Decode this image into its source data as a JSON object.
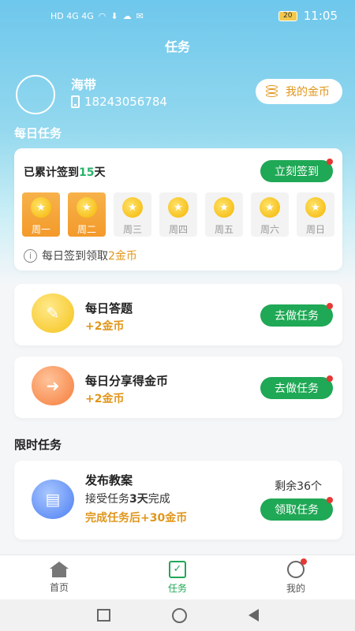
{
  "status_bar": {
    "left_indicators": "HD 4G 4G",
    "battery_level": "20",
    "time": "11:05"
  },
  "header": {
    "title": "任务"
  },
  "user": {
    "name": "海带",
    "phone": "18243056784",
    "coin_button_label": "我的金币"
  },
  "daily": {
    "section_title": "每日任务",
    "checkin": {
      "title_prefix": "已累计签到",
      "days_count": "15",
      "title_suffix": "天",
      "button_label": "立刻签到",
      "note_prefix": "每日签到领取",
      "note_amount": "2金币",
      "days": [
        {
          "label": "周一",
          "checked": true
        },
        {
          "label": "周二",
          "checked": true
        },
        {
          "label": "周三",
          "checked": false
        },
        {
          "label": "周四",
          "checked": false
        },
        {
          "label": "周五",
          "checked": false
        },
        {
          "label": "周六",
          "checked": false
        },
        {
          "label": "周日",
          "checked": false
        }
      ]
    },
    "tasks": [
      {
        "name": "每日答题",
        "reward": "+2金币",
        "button_label": "去做任务",
        "icon": "quiz-icon"
      },
      {
        "name": "每日分享得金币",
        "reward": "+2金币",
        "button_label": "去做任务",
        "icon": "share-icon"
      }
    ]
  },
  "limited": {
    "section_title": "限时任务",
    "task": {
      "name": "发布教案",
      "desc_prefix": "接受任务",
      "desc_days": "3天",
      "desc_suffix": "完成",
      "reward": "完成任务后+30金币",
      "remaining": "剩余36个",
      "button_label": "领取任务",
      "icon": "document-icon"
    }
  },
  "tab_bar": {
    "tabs": [
      {
        "label": "首页",
        "icon": "home-icon",
        "active": false
      },
      {
        "label": "任务",
        "icon": "task-icon",
        "active": true
      },
      {
        "label": "我的",
        "icon": "profile-icon",
        "active": false
      }
    ]
  },
  "colors": {
    "accent_green": "#1fa855",
    "coin_orange": "#e0961b",
    "header_blue": "#6ec7ec",
    "badge_red": "#e53935"
  }
}
